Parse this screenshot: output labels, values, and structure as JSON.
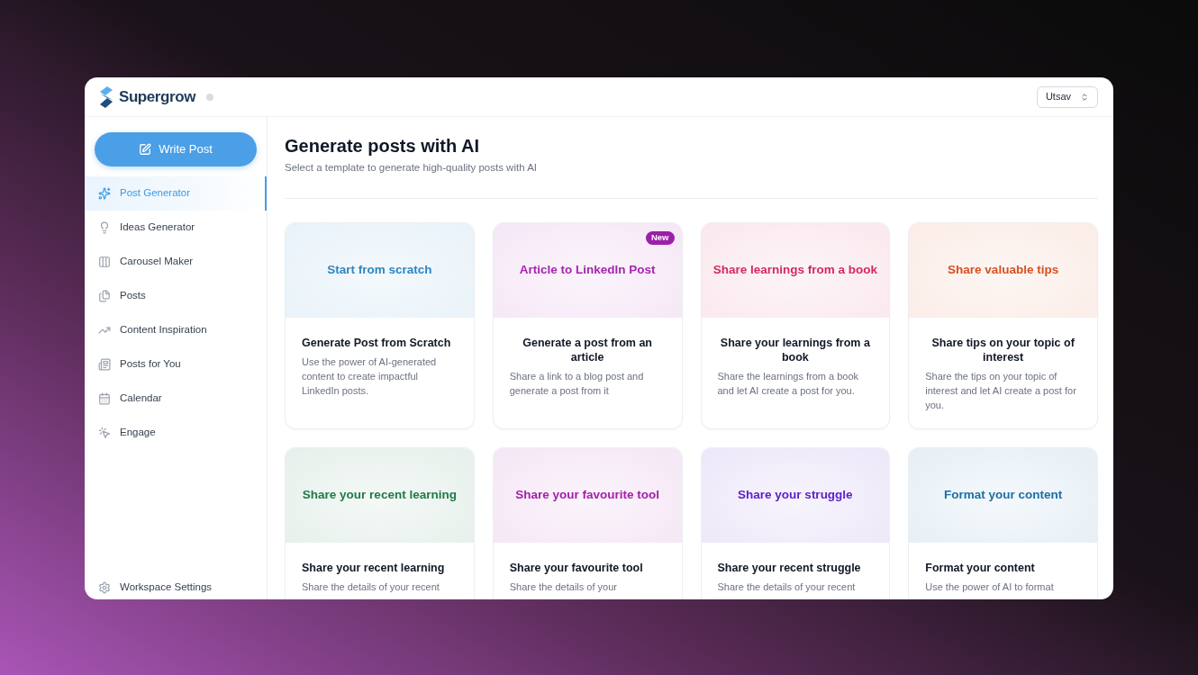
{
  "header": {
    "brand": "Supergrow",
    "workspace": "Utsav"
  },
  "sidebar": {
    "action": "Write Post",
    "items": [
      {
        "label": "Post Generator",
        "selected": true
      },
      {
        "label": "Ideas Generator",
        "selected": false
      },
      {
        "label": "Carousel Maker",
        "selected": false
      },
      {
        "label": "Posts",
        "selected": false
      },
      {
        "label": "Content Inspiration",
        "selected": false
      },
      {
        "label": "Posts for You",
        "selected": false
      },
      {
        "label": "Calendar",
        "selected": false
      },
      {
        "label": "Engage",
        "selected": false
      }
    ],
    "footer_item": "Workspace Settings"
  },
  "main": {
    "title": "Generate posts with AI",
    "subtitle": "Select a template to generate high-quality posts with AI",
    "cards": [
      {
        "banner": "Start from scratch",
        "color": "#2c86c7",
        "title": "Generate Post from Scratch",
        "description": "Use the power of AI-generated content to create impactful LinkedIn posts."
      },
      {
        "banner": "Article to LinkedIn Post",
        "color": "#a625b0",
        "badge": "New",
        "title": "Generate a post from an article",
        "description": "Share a link to a blog post and generate a post from it"
      },
      {
        "banner": "Share learnings from a book",
        "color": "#d42a5e",
        "title": "Share your learnings from a book",
        "description": "Share the learnings from a book and let AI create a post for you."
      },
      {
        "banner": "Share valuable tips",
        "color": "#d84f1f",
        "title": "Share tips on your topic of interest",
        "description": "Share the tips on your topic of interest and let AI create a post for you."
      },
      {
        "banner": "Share your recent learning",
        "color": "#1f7a48",
        "title": "Share your recent learning",
        "description": "Share the details of your recent"
      },
      {
        "banner": "Share your favourite tool",
        "color": "#a31fa8",
        "title": "Share your favourite tool",
        "description": "Share the details of your"
      },
      {
        "banner": "Share your struggle",
        "color": "#5b21c8",
        "title": "Share your recent struggle",
        "description": "Share the details of your recent"
      },
      {
        "banner": "Format your content",
        "color": "#1d6fa5",
        "title": "Format your content",
        "description": "Use the power of AI to format"
      }
    ]
  }
}
